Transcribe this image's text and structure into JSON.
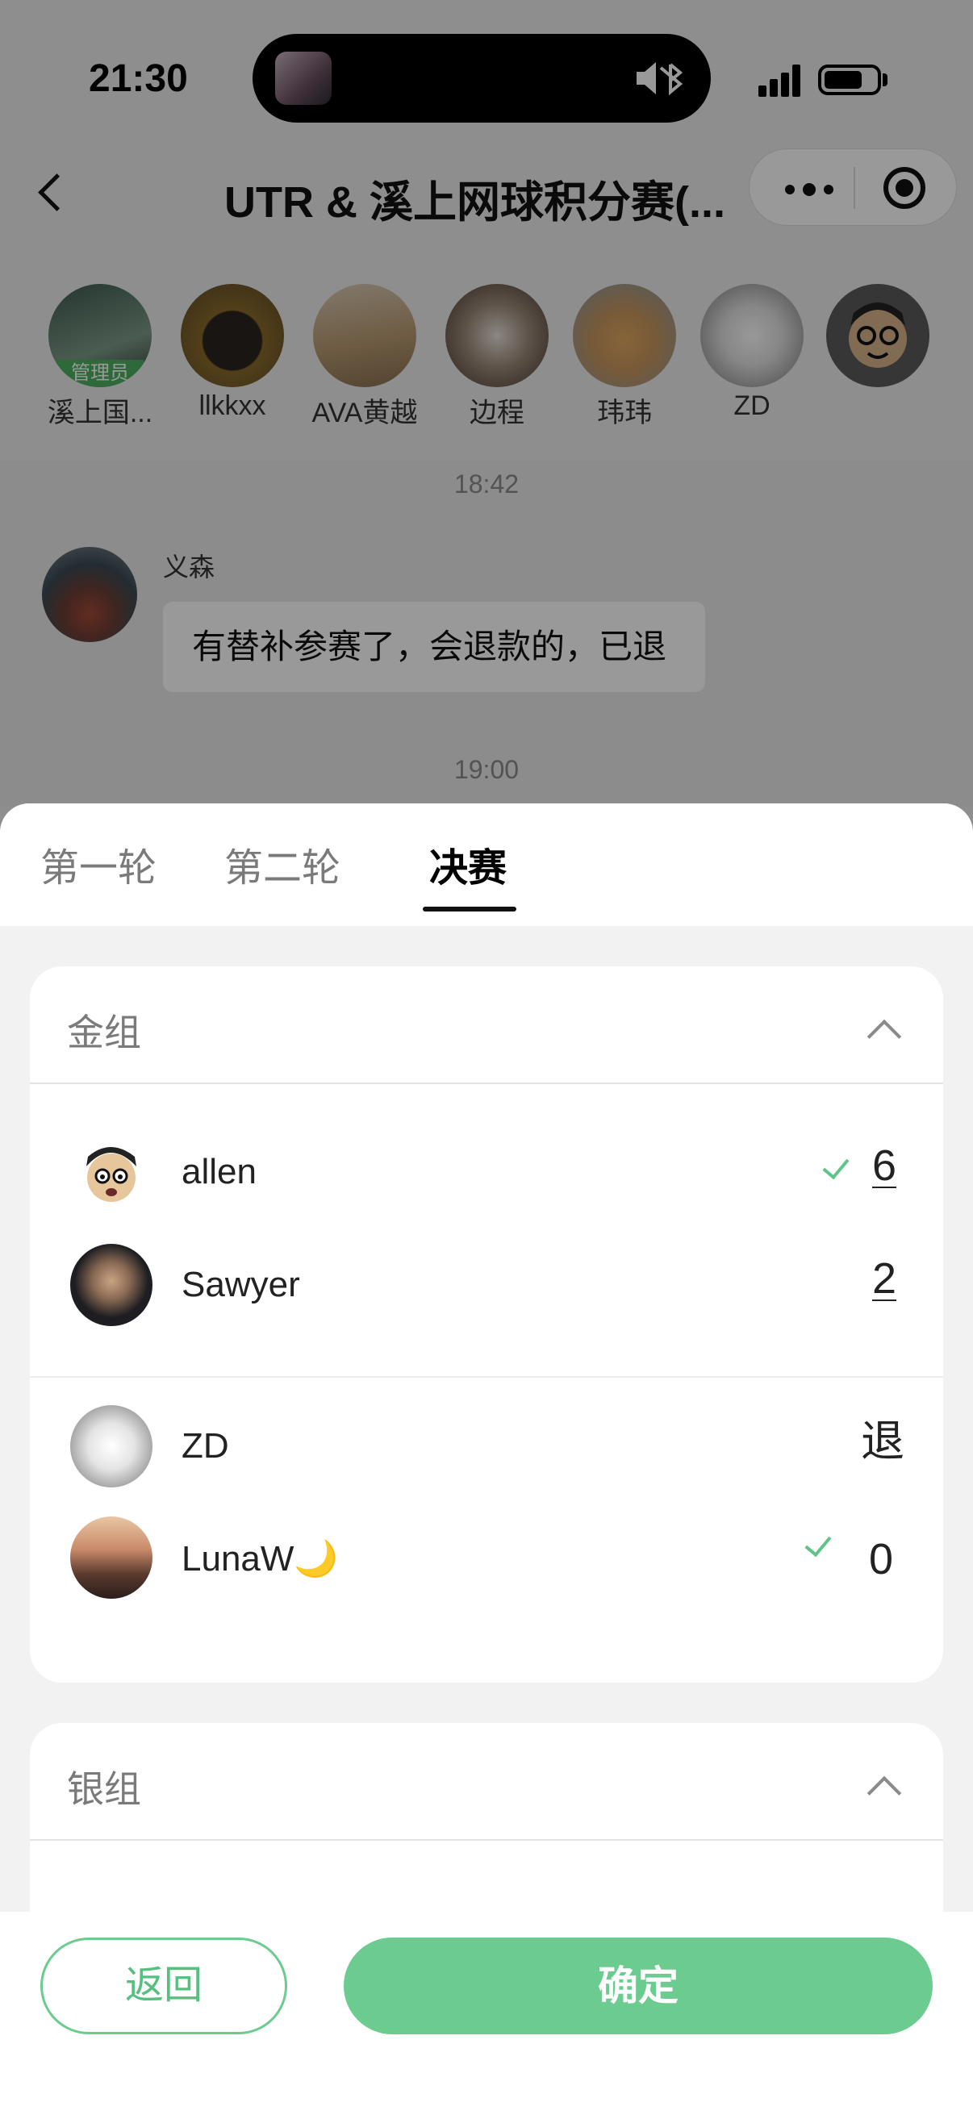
{
  "status_bar": {
    "time": "21:30"
  },
  "navbar": {
    "title": "UTR & 溪上网球积分赛(..."
  },
  "members": [
    {
      "name": "溪上国...",
      "badge": "管理员",
      "avatar_color": "#3d5a4e"
    },
    {
      "name": "llkkxx",
      "avatar_color": "#5a4a2a"
    },
    {
      "name": "AVA黄越",
      "avatar_color": "#b89a72"
    },
    {
      "name": "边程",
      "avatar_color": "#9a8878"
    },
    {
      "name": "玮玮",
      "avatar_color": "#c79660"
    },
    {
      "name": "ZD",
      "avatar_color": "#c8c8c8"
    }
  ],
  "chat": {
    "timestamp_1": "18:42",
    "sender": "义森",
    "message": "有替补参赛了，会退款的，已退",
    "timestamp_2": "19:00"
  },
  "tabs": [
    {
      "label": "第一轮",
      "active": false
    },
    {
      "label": "第二轮",
      "active": false
    },
    {
      "label": "决赛",
      "active": true
    }
  ],
  "groups": [
    {
      "title": "金组",
      "matches": [
        {
          "players": [
            {
              "name": "allen",
              "score": "6",
              "winner": true
            },
            {
              "name": "Sawyer",
              "score": "2",
              "winner": false
            }
          ]
        },
        {
          "players": [
            {
              "name": "ZD",
              "score": "退",
              "winner": false
            },
            {
              "name": "LunaW🌙",
              "score": "0",
              "winner": true
            }
          ]
        }
      ]
    },
    {
      "title": "银组",
      "matches": []
    }
  ],
  "buttons": {
    "back": "返回",
    "confirm": "确定"
  },
  "colors": {
    "accent": "#6ccb8e",
    "check": "#5fc487",
    "admin_badge": "#4caf60"
  }
}
